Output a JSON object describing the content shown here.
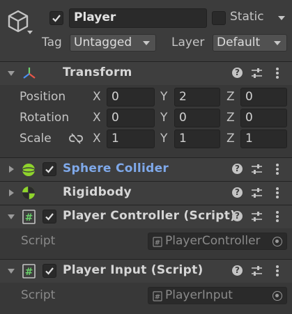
{
  "object": {
    "active": true,
    "name": "Player",
    "static_label": "Static",
    "static": false,
    "tag_label": "Tag",
    "tag_value": "Untagged",
    "layer_label": "Layer",
    "layer_value": "Default"
  },
  "transform": {
    "title": "Transform",
    "rows": [
      {
        "label": "Position",
        "x": "0",
        "y": "2",
        "z": "0"
      },
      {
        "label": "Rotation",
        "x": "0",
        "y": "0",
        "z": "0"
      },
      {
        "label": "Scale",
        "x": "1",
        "y": "1",
        "z": "1"
      }
    ],
    "axis_labels": [
      "X",
      "Y",
      "Z"
    ]
  },
  "components": [
    {
      "title": "Sphere Collider",
      "enabled": true,
      "expanded": false,
      "title_color": "#7fa9ea",
      "icon": "sphere-collider-icon"
    },
    {
      "title": "Rigidbody",
      "expanded": false,
      "icon": "rigidbody-icon"
    },
    {
      "title": "Player Controller (Script)",
      "enabled": true,
      "expanded": true,
      "icon": "script-icon",
      "field_label": "Script",
      "field_value": "PlayerController"
    },
    {
      "title": "Player Input (Script)",
      "enabled": true,
      "expanded": true,
      "icon": "script-icon",
      "field_label": "Script",
      "field_value": "PlayerInput"
    }
  ],
  "icons": {
    "help": "?",
    "accent": "#7fa9ea"
  }
}
